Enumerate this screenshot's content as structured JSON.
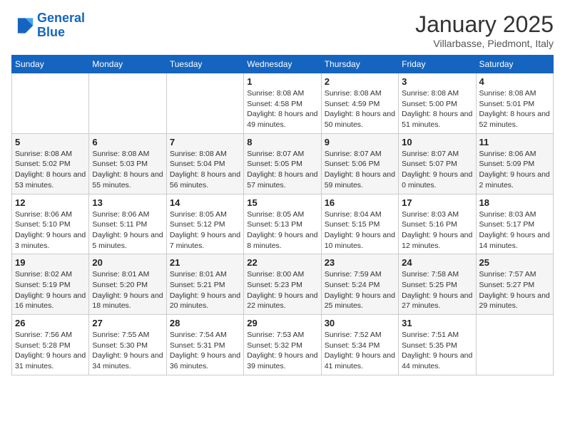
{
  "logo": {
    "line1": "General",
    "line2": "Blue"
  },
  "title": "January 2025",
  "subtitle": "Villarbasse, Piedmont, Italy",
  "weekdays": [
    "Sunday",
    "Monday",
    "Tuesday",
    "Wednesday",
    "Thursday",
    "Friday",
    "Saturday"
  ],
  "weeks": [
    [
      {
        "day": "",
        "info": ""
      },
      {
        "day": "",
        "info": ""
      },
      {
        "day": "",
        "info": ""
      },
      {
        "day": "1",
        "info": "Sunrise: 8:08 AM\nSunset: 4:58 PM\nDaylight: 8 hours\nand 49 minutes."
      },
      {
        "day": "2",
        "info": "Sunrise: 8:08 AM\nSunset: 4:59 PM\nDaylight: 8 hours\nand 50 minutes."
      },
      {
        "day": "3",
        "info": "Sunrise: 8:08 AM\nSunset: 5:00 PM\nDaylight: 8 hours\nand 51 minutes."
      },
      {
        "day": "4",
        "info": "Sunrise: 8:08 AM\nSunset: 5:01 PM\nDaylight: 8 hours\nand 52 minutes."
      }
    ],
    [
      {
        "day": "5",
        "info": "Sunrise: 8:08 AM\nSunset: 5:02 PM\nDaylight: 8 hours\nand 53 minutes."
      },
      {
        "day": "6",
        "info": "Sunrise: 8:08 AM\nSunset: 5:03 PM\nDaylight: 8 hours\nand 55 minutes."
      },
      {
        "day": "7",
        "info": "Sunrise: 8:08 AM\nSunset: 5:04 PM\nDaylight: 8 hours\nand 56 minutes."
      },
      {
        "day": "8",
        "info": "Sunrise: 8:07 AM\nSunset: 5:05 PM\nDaylight: 8 hours\nand 57 minutes."
      },
      {
        "day": "9",
        "info": "Sunrise: 8:07 AM\nSunset: 5:06 PM\nDaylight: 8 hours\nand 59 minutes."
      },
      {
        "day": "10",
        "info": "Sunrise: 8:07 AM\nSunset: 5:07 PM\nDaylight: 9 hours\nand 0 minutes."
      },
      {
        "day": "11",
        "info": "Sunrise: 8:06 AM\nSunset: 5:09 PM\nDaylight: 9 hours\nand 2 minutes."
      }
    ],
    [
      {
        "day": "12",
        "info": "Sunrise: 8:06 AM\nSunset: 5:10 PM\nDaylight: 9 hours\nand 3 minutes."
      },
      {
        "day": "13",
        "info": "Sunrise: 8:06 AM\nSunset: 5:11 PM\nDaylight: 9 hours\nand 5 minutes."
      },
      {
        "day": "14",
        "info": "Sunrise: 8:05 AM\nSunset: 5:12 PM\nDaylight: 9 hours\nand 7 minutes."
      },
      {
        "day": "15",
        "info": "Sunrise: 8:05 AM\nSunset: 5:13 PM\nDaylight: 9 hours\nand 8 minutes."
      },
      {
        "day": "16",
        "info": "Sunrise: 8:04 AM\nSunset: 5:15 PM\nDaylight: 9 hours\nand 10 minutes."
      },
      {
        "day": "17",
        "info": "Sunrise: 8:03 AM\nSunset: 5:16 PM\nDaylight: 9 hours\nand 12 minutes."
      },
      {
        "day": "18",
        "info": "Sunrise: 8:03 AM\nSunset: 5:17 PM\nDaylight: 9 hours\nand 14 minutes."
      }
    ],
    [
      {
        "day": "19",
        "info": "Sunrise: 8:02 AM\nSunset: 5:19 PM\nDaylight: 9 hours\nand 16 minutes."
      },
      {
        "day": "20",
        "info": "Sunrise: 8:01 AM\nSunset: 5:20 PM\nDaylight: 9 hours\nand 18 minutes."
      },
      {
        "day": "21",
        "info": "Sunrise: 8:01 AM\nSunset: 5:21 PM\nDaylight: 9 hours\nand 20 minutes."
      },
      {
        "day": "22",
        "info": "Sunrise: 8:00 AM\nSunset: 5:23 PM\nDaylight: 9 hours\nand 22 minutes."
      },
      {
        "day": "23",
        "info": "Sunrise: 7:59 AM\nSunset: 5:24 PM\nDaylight: 9 hours\nand 25 minutes."
      },
      {
        "day": "24",
        "info": "Sunrise: 7:58 AM\nSunset: 5:25 PM\nDaylight: 9 hours\nand 27 minutes."
      },
      {
        "day": "25",
        "info": "Sunrise: 7:57 AM\nSunset: 5:27 PM\nDaylight: 9 hours\nand 29 minutes."
      }
    ],
    [
      {
        "day": "26",
        "info": "Sunrise: 7:56 AM\nSunset: 5:28 PM\nDaylight: 9 hours\nand 31 minutes."
      },
      {
        "day": "27",
        "info": "Sunrise: 7:55 AM\nSunset: 5:30 PM\nDaylight: 9 hours\nand 34 minutes."
      },
      {
        "day": "28",
        "info": "Sunrise: 7:54 AM\nSunset: 5:31 PM\nDaylight: 9 hours\nand 36 minutes."
      },
      {
        "day": "29",
        "info": "Sunrise: 7:53 AM\nSunset: 5:32 PM\nDaylight: 9 hours\nand 39 minutes."
      },
      {
        "day": "30",
        "info": "Sunrise: 7:52 AM\nSunset: 5:34 PM\nDaylight: 9 hours\nand 41 minutes."
      },
      {
        "day": "31",
        "info": "Sunrise: 7:51 AM\nSunset: 5:35 PM\nDaylight: 9 hours\nand 44 minutes."
      },
      {
        "day": "",
        "info": ""
      }
    ]
  ]
}
